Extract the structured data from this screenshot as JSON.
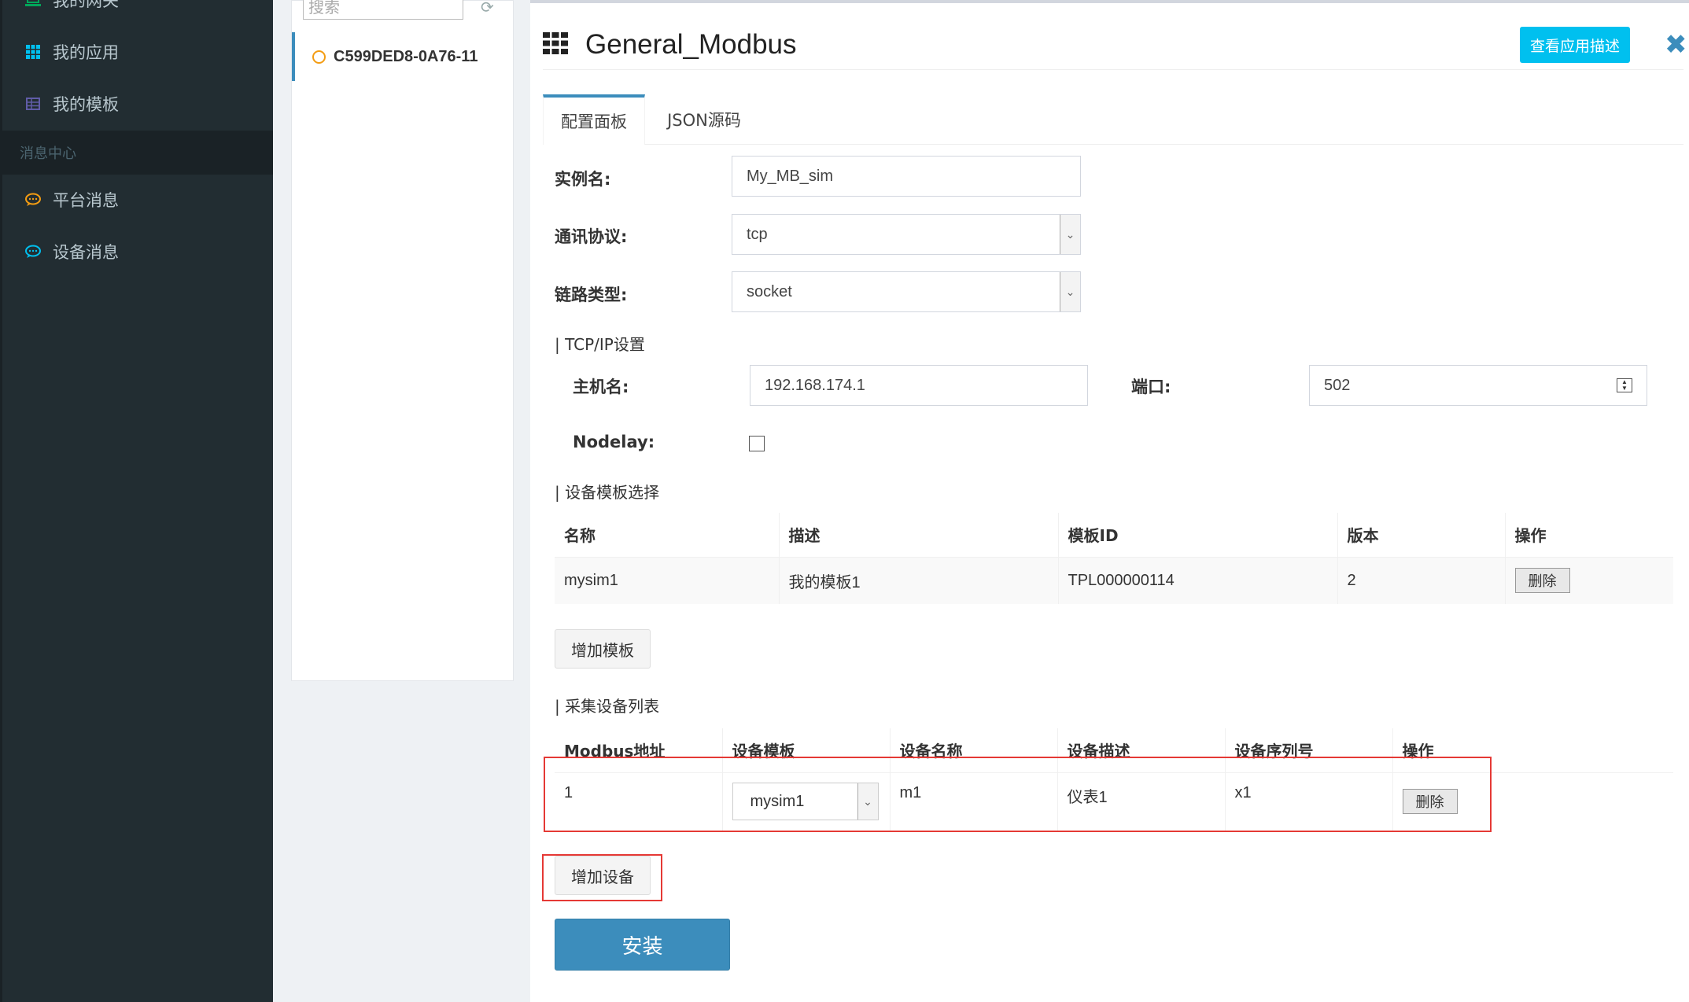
{
  "sidebar": {
    "items": [
      {
        "label": "我的网关",
        "icon": "laptop-icon",
        "color": "#00a65a"
      },
      {
        "label": "我的应用",
        "icon": "grid-icon",
        "color": "#00c0ef"
      },
      {
        "label": "我的模板",
        "icon": "table-icon",
        "color": "#605ca8"
      }
    ],
    "section_header": "消息中心",
    "msg_items": [
      {
        "label": "平台消息",
        "icon": "comment-icon",
        "color": "#f39c12"
      },
      {
        "label": "设备消息",
        "icon": "comments-icon",
        "color": "#00c0ef"
      }
    ]
  },
  "midpanel": {
    "search_placeholder": "搜索",
    "gateway": "C599DED8-0A76-11"
  },
  "main": {
    "title": "General_Modbus",
    "desc_button": "查看应用描述",
    "tabs": [
      "配置面板",
      "JSON源码"
    ],
    "form": {
      "instance_label": "实例名:",
      "instance_value": "My_MB_sim",
      "protocol_label": "通讯协议:",
      "protocol_value": "tcp",
      "link_label": "链路类型:",
      "link_value": "socket",
      "tcp_section": "| TCP/IP设置",
      "host_label": "主机名:",
      "host_value": "192.168.174.1",
      "port_label": "端口:",
      "port_value": "502",
      "nodelay_label": "Nodelay:"
    },
    "template_section": "| 设备模板选择",
    "template_table": {
      "headers": [
        "名称",
        "描述",
        "模板ID",
        "版本",
        "操作"
      ],
      "rows": [
        [
          "mysim1",
          "我的模板1",
          "TPL000000114",
          "2",
          "删除"
        ]
      ]
    },
    "add_template": "增加模板",
    "device_section": "| 采集设备列表",
    "device_table": {
      "headers": [
        "Modbus地址",
        "设备模板",
        "设备名称",
        "设备描述",
        "设备序列号",
        "操作"
      ],
      "rows": [
        [
          "1",
          "mysim1",
          "m1",
          "仪表1",
          "x1",
          "删除"
        ]
      ]
    },
    "add_device": "增加设备",
    "install": "安装"
  }
}
